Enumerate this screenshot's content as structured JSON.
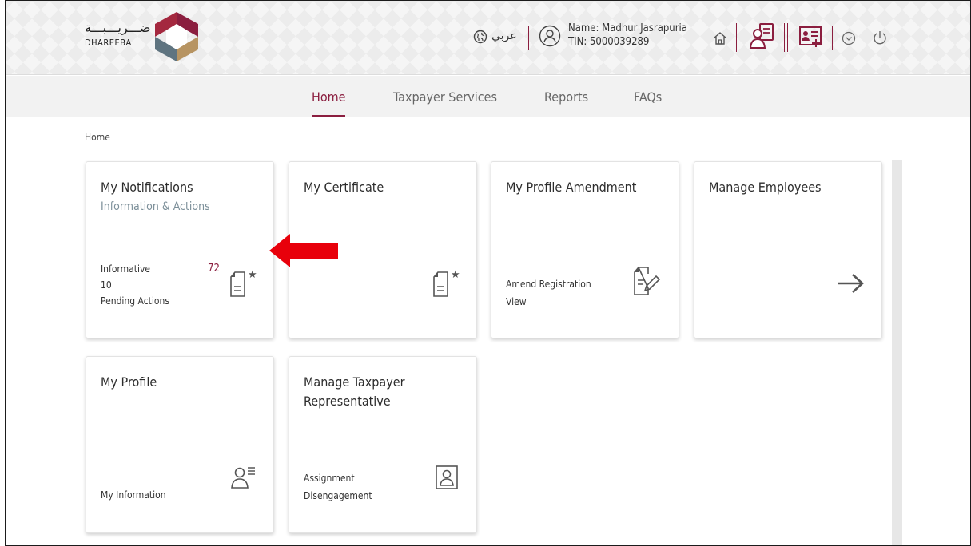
{
  "header": {
    "logo_ar": "ضـــريـــبـــة",
    "logo_en": "DHAREEBA",
    "language_label": "عربي",
    "user_name": "Name: Madhur Jasrapuria",
    "user_tin": "TIN: 5000039289"
  },
  "nav": {
    "items": [
      {
        "label": "Home",
        "active": true
      },
      {
        "label": "Taxpayer Services",
        "active": false
      },
      {
        "label": "Reports",
        "active": false
      },
      {
        "label": "FAQs",
        "active": false
      }
    ]
  },
  "breadcrumb": "Home",
  "cards": {
    "notifications": {
      "title": "My Notifications",
      "subtitle": "Information & Actions",
      "informative_label": "Informative",
      "informative_count": "72",
      "pending_count": "10",
      "pending_label": "Pending Actions"
    },
    "certificate": {
      "title": "My Certificate"
    },
    "profile_amendment": {
      "title": "My Profile Amendment",
      "link1": "Amend Registration",
      "link2": "View"
    },
    "manage_employees": {
      "title": "Manage Employees"
    },
    "profile": {
      "title": "My Profile",
      "link1": "My Information"
    },
    "representative": {
      "title_line1": "Manage Taxpayer",
      "title_line2": "Representative",
      "link1": "Assignment",
      "link2": "Disengagement"
    }
  },
  "colors": {
    "accent": "#8b1e3f",
    "annotation_arrow": "#e8000b"
  }
}
